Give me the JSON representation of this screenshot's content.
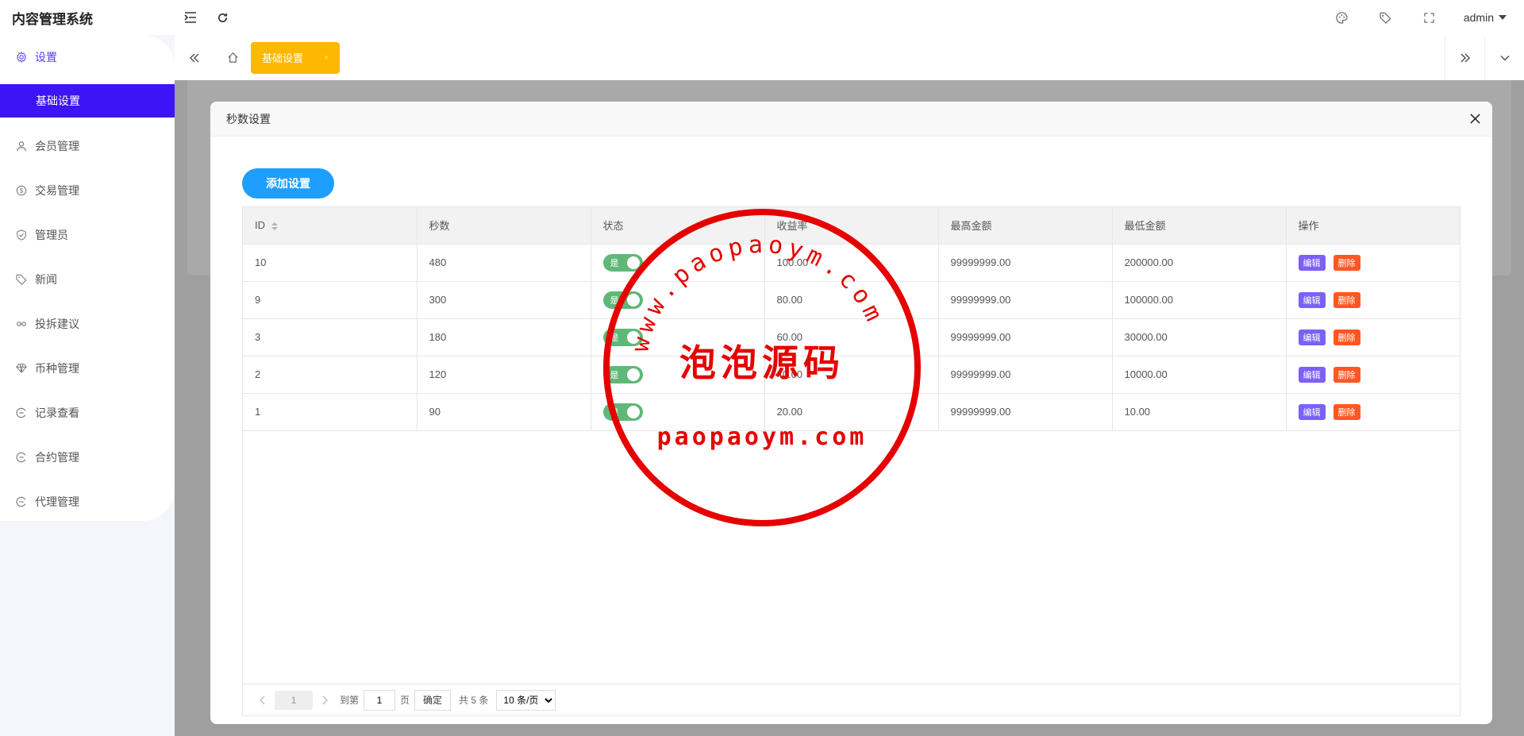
{
  "app": {
    "title": "内容管理系统"
  },
  "topbar": {
    "user": "admin"
  },
  "sidebar": {
    "items": [
      {
        "label": "设置",
        "icon": "gear-icon"
      },
      {
        "label": "会员管理",
        "icon": "user-icon"
      },
      {
        "label": "交易管理",
        "icon": "dollar-icon"
      },
      {
        "label": "管理员",
        "icon": "shield-icon"
      },
      {
        "label": "新闻",
        "icon": "tag-icon"
      },
      {
        "label": "投拆建议",
        "icon": "link-icon"
      },
      {
        "label": "币种管理",
        "icon": "diamond-icon"
      },
      {
        "label": "记录查看",
        "icon": "record-icon"
      },
      {
        "label": "合约管理",
        "icon": "record-icon"
      },
      {
        "label": "代理管理",
        "icon": "record-icon"
      }
    ],
    "sub_active": "基础设置"
  },
  "tabs": {
    "active": "基础设置",
    "close": "×"
  },
  "modal": {
    "title": "秒数设置",
    "add_button": "添加设置",
    "columns": [
      "ID",
      "秒数",
      "状态",
      "收益率",
      "最高金额",
      "最低金额",
      "操作"
    ],
    "rows": [
      {
        "id": "10",
        "seconds": "480",
        "status": "是",
        "rate": "100.00",
        "max": "99999999.00",
        "min": "200000.00"
      },
      {
        "id": "9",
        "seconds": "300",
        "status": "是",
        "rate": "80.00",
        "max": "99999999.00",
        "min": "100000.00"
      },
      {
        "id": "3",
        "seconds": "180",
        "status": "是",
        "rate": "60.00",
        "max": "99999999.00",
        "min": "30000.00"
      },
      {
        "id": "2",
        "seconds": "120",
        "status": "是",
        "rate": "40.00",
        "max": "99999999.00",
        "min": "10000.00"
      },
      {
        "id": "1",
        "seconds": "90",
        "status": "是",
        "rate": "20.00",
        "max": "99999999.00",
        "min": "10.00"
      }
    ],
    "edit_label": "编辑",
    "delete_label": "删除",
    "pager": {
      "current": "1",
      "goto_prefix": "到第",
      "goto_value": "1",
      "goto_suffix": "页",
      "confirm": "确定",
      "total": "共 5 条",
      "page_size": "10 条/页"
    }
  },
  "watermark": {
    "arc_text": "www.paopaoym.com",
    "center_text": "泡泡源码",
    "bottom_text": "paopaoym.com"
  }
}
